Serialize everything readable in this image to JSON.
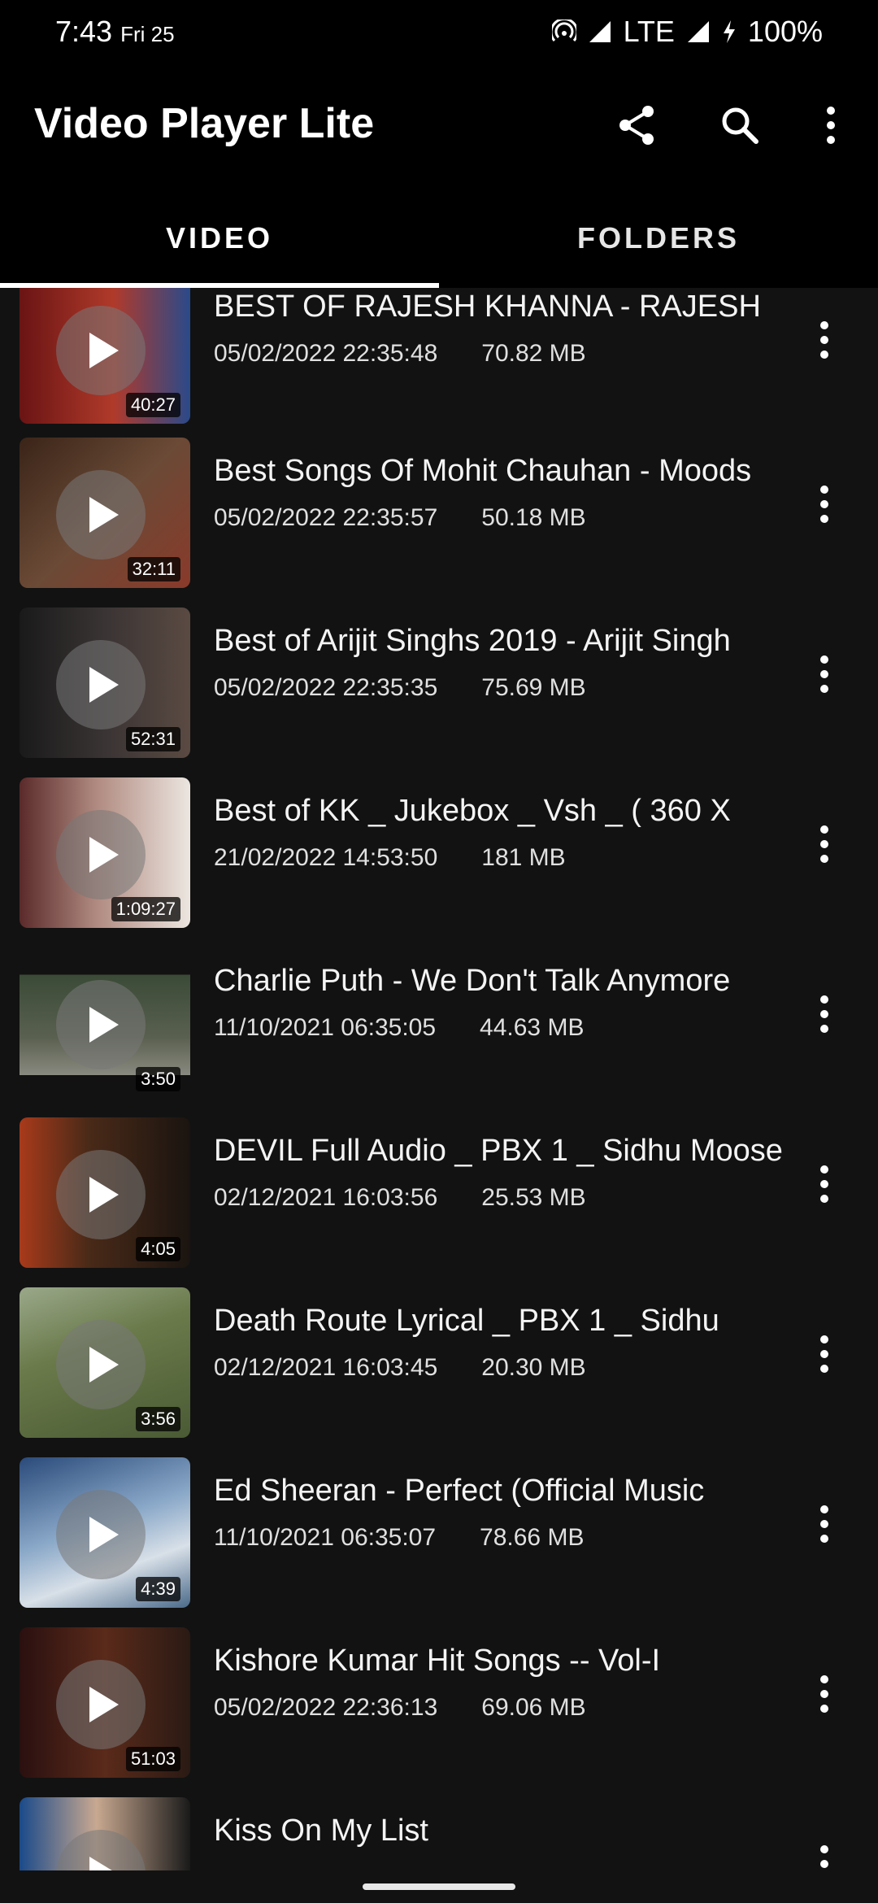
{
  "status": {
    "time": "7:43",
    "date": "Fri 25",
    "network": "LTE",
    "battery": "100%"
  },
  "appbar": {
    "title": "Video Player Lite",
    "actions": [
      "share-icon",
      "search-icon",
      "more-vert-icon"
    ]
  },
  "tabs": [
    {
      "label": "VIDEO",
      "active": true
    },
    {
      "label": "FOLDERS",
      "active": false
    }
  ],
  "videos": [
    {
      "title": "BEST OF RAJESH KHANNA - RAJESH",
      "date": "05/02/2022 22:35:48",
      "size": "70.82 MB",
      "duration": "40:27",
      "thumb_color": "#7a2020"
    },
    {
      "title": "Best Songs Of Mohit Chauhan - Moods",
      "date": "05/02/2022 22:35:57",
      "size": "50.18 MB",
      "duration": "32:11",
      "thumb_color": "#5a3a2a"
    },
    {
      "title": "Best of Arijit Singhs 2019 - Arijit Singh",
      "date": "05/02/2022 22:35:35",
      "size": "75.69 MB",
      "duration": "52:31",
      "thumb_color": "#2a2a2a"
    },
    {
      "title": "Best of KK _ Jukebox _ Vsh _ ( 360 X",
      "date": "21/02/2022 14:53:50",
      "size": "181 MB",
      "duration": "1:09:27",
      "thumb_color": "#d9d3cc"
    },
    {
      "title": "Charlie Puth - We Don't Talk Anymore",
      "date": "11/10/2021 06:35:05",
      "size": "44.63 MB",
      "duration": "3:50",
      "thumb_color": "#4a5040"
    },
    {
      "title": "DEVIL Full Audio _ PBX 1 _ Sidhu Moose",
      "date": "02/12/2021 16:03:56",
      "size": "25.53 MB",
      "duration": "4:05",
      "thumb_color": "#3a2418"
    },
    {
      "title": "Death Route Lyrical _ PBX 1 _ Sidhu",
      "date": "02/12/2021 16:03:45",
      "size": "20.30 MB",
      "duration": "3:56",
      "thumb_color": "#6a7a4a"
    },
    {
      "title": "Ed Sheeran - Perfect (Official Music",
      "date": "11/10/2021 06:35:07",
      "size": "78.66 MB",
      "duration": "4:39",
      "thumb_color": "#6a8aa8"
    },
    {
      "title": "Kishore Kumar Hit Songs -- Vol-I",
      "date": "05/02/2022 22:36:13",
      "size": "69.06 MB",
      "duration": "51:03",
      "thumb_color": "#3a1a1a"
    },
    {
      "title": "Kiss On My List",
      "date": "",
      "size": "",
      "duration": "",
      "thumb_color": "#2e6aa8"
    }
  ]
}
